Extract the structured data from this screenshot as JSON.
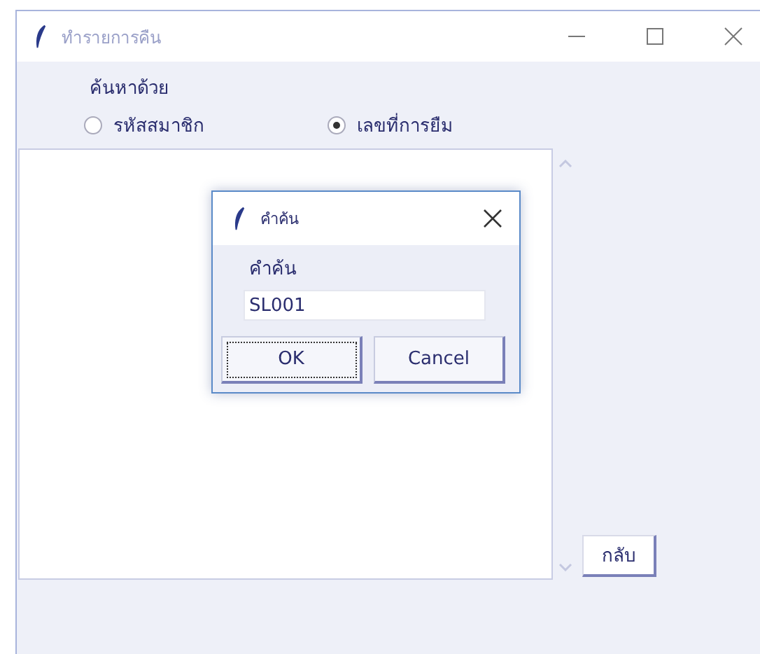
{
  "window": {
    "title": "ทำรายการคืน"
  },
  "search_label": "ค้นหาด้วย",
  "radios": [
    {
      "label": "รหัสสมาชิก",
      "selected": false
    },
    {
      "label": "เลขที่การยืม",
      "selected": true
    }
  ],
  "back_button": "กลับ",
  "dialog": {
    "title": "คำค้น",
    "field_label": "คำค้น",
    "field_value": "SL001",
    "buttons": [
      {
        "label": "OK",
        "focused": true
      },
      {
        "label": "Cancel",
        "focused": false
      }
    ]
  }
}
